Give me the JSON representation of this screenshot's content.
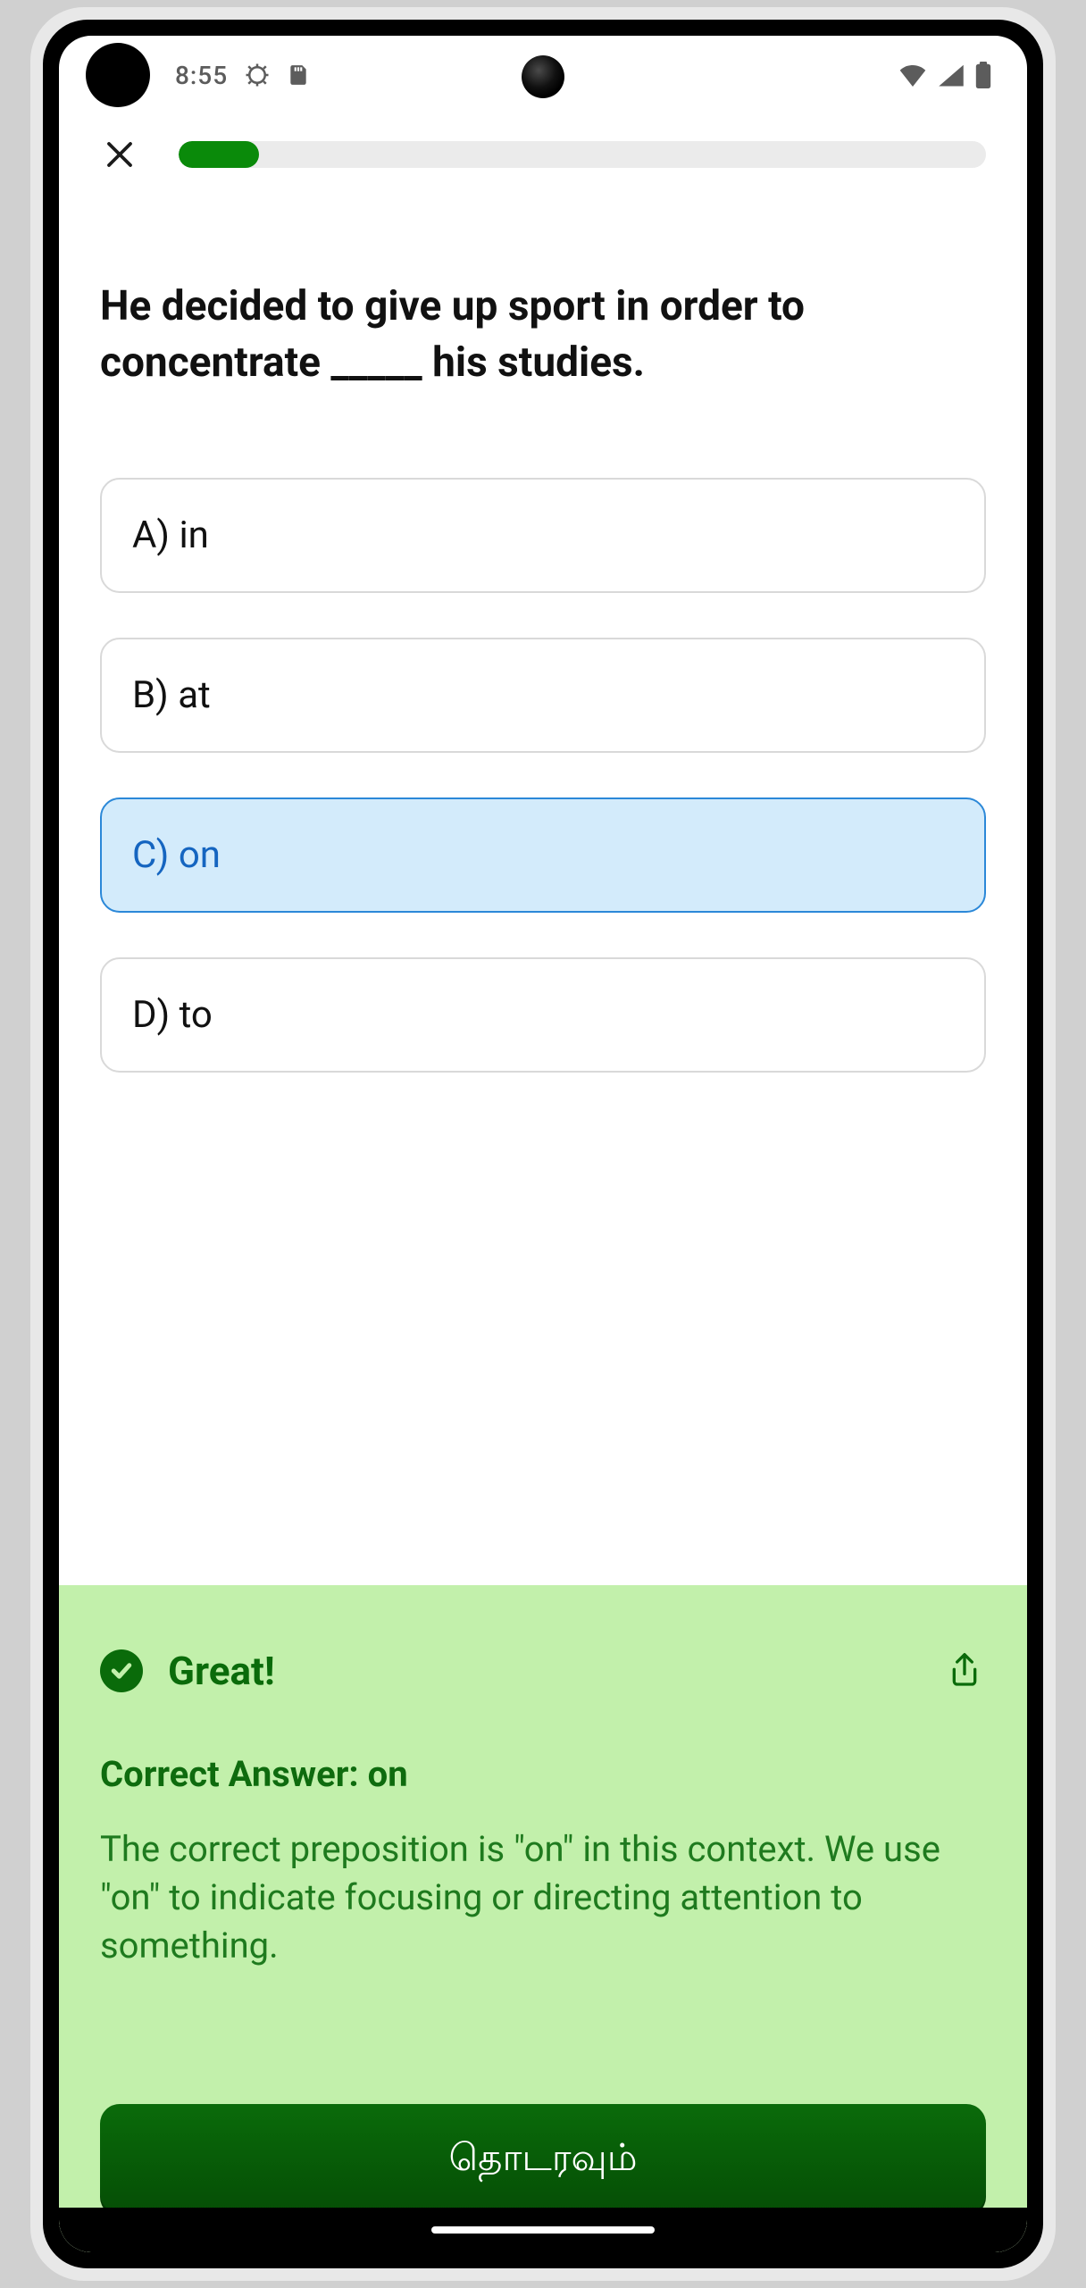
{
  "status": {
    "time": "8:55",
    "icons": [
      "gear-icon",
      "sd-card-icon"
    ],
    "right_icons": [
      "wifi-icon",
      "signal-icon",
      "battery-icon"
    ]
  },
  "progress": {
    "percent": 10
  },
  "question": "He decided to give up sport in order to concentrate _____ his studies.",
  "options": [
    {
      "label": "A) in",
      "selected": false
    },
    {
      "label": "B) at",
      "selected": false
    },
    {
      "label": "C) on",
      "selected": true
    },
    {
      "label": "D) to",
      "selected": false
    }
  ],
  "feedback": {
    "title": "Great!",
    "correct_label": "Correct Answer: on",
    "explanation": "The correct preposition is \"on\" in this context. We use \"on\" to indicate focusing or directing attention to something.",
    "continue_label": "தொடரவும்"
  },
  "colors": {
    "accent_green": "#0a8a0a",
    "feedback_bg": "#c2f0ab",
    "selected_blue": "#2b88d8"
  }
}
